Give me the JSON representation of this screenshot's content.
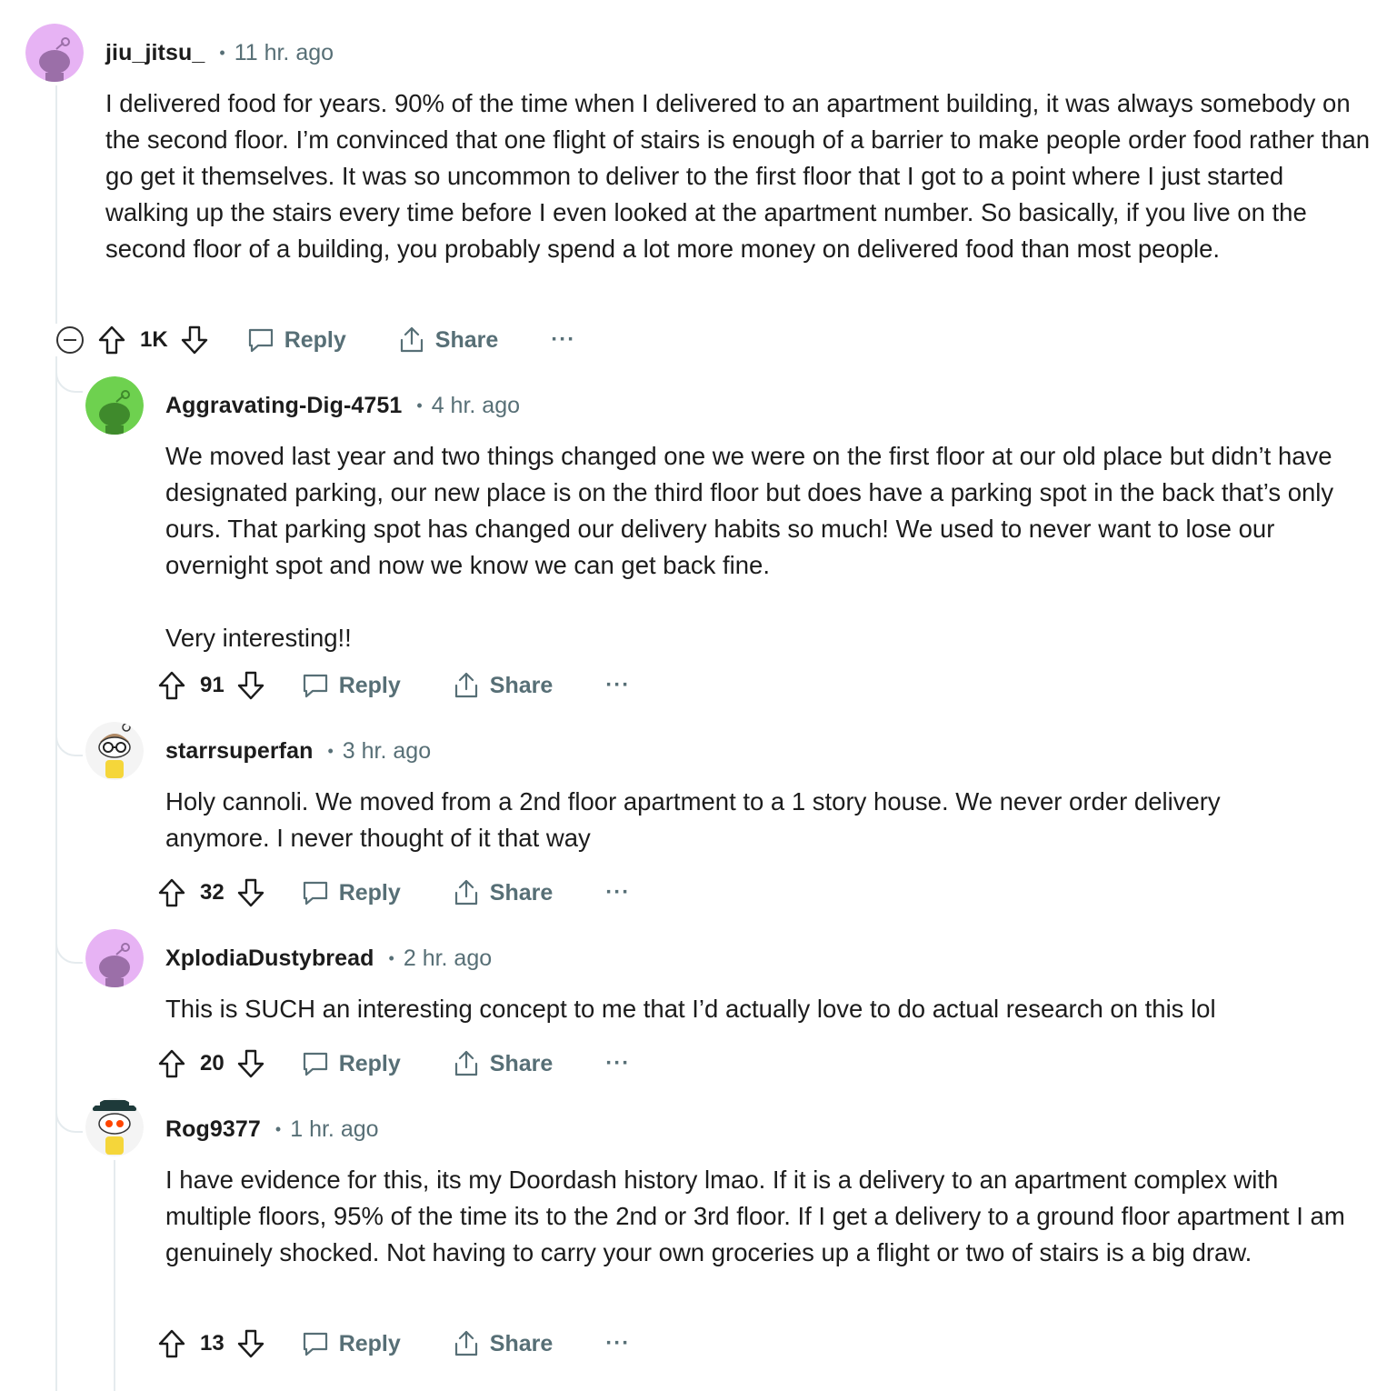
{
  "colors": {
    "meta_text": "#576f76",
    "thread_line": "#e5ebee",
    "text": "#1c1c1c"
  },
  "comments": [
    {
      "author": "jiu_jitsu_",
      "separator": "•",
      "time": "11 hr. ago",
      "body": "I delivered food for years. 90% of the time when I delivered to an apartment building, it was always somebody on the second floor. I’m convinced that one flight of stairs is enough of a barrier to make people order food rather than go get it themselves. It was so uncommon to deliver to the first floor that I got to a point where I just started walking up the stairs every time before I even looked at the apartment number. So basically, if you live on the second floor of a building, you probably spend a lot more money on delivered food than most people.",
      "score": "1K",
      "reply_label": "Reply",
      "share_label": "Share",
      "more_label": "···",
      "avatar": "snoo-purple"
    },
    {
      "author": "Aggravating-Dig-4751",
      "separator": "•",
      "time": "4 hr. ago",
      "body": "We moved last year and two things changed one we were on the first floor at our old place but didn’t have designated parking, our new place is on the third floor but does have a parking spot in the back that’s only ours. That parking spot has changed our delivery habits so much! We used to never want to lose our overnight spot and now we know we can get back fine.\n\nVery interesting!!",
      "score": "91",
      "reply_label": "Reply",
      "share_label": "Share",
      "more_label": "···",
      "avatar": "snoo-green"
    },
    {
      "author": "starrsuperfan",
      "separator": "•",
      "time": "3 hr. ago",
      "body": "Holy cannoli. We moved from a 2nd floor apartment to a 1 story house. We never order delivery anymore. I never thought of it that way",
      "score": "32",
      "reply_label": "Reply",
      "share_label": "Share",
      "more_label": "···",
      "avatar": "snoo-glasses"
    },
    {
      "author": "XplodiaDustybread",
      "separator": "•",
      "time": "2 hr. ago",
      "body": "This is SUCH an interesting concept to me that I’d actually love to do actual research on this lol",
      "score": "20",
      "reply_label": "Reply",
      "share_label": "Share",
      "more_label": "···",
      "avatar": "snoo-purple"
    },
    {
      "author": "Rog9377",
      "separator": "•",
      "time": "1 hr. ago",
      "body": "I have evidence for this, its my Doordash history lmao. If it is a delivery to an apartment complex with multiple floors, 95% of the time its to the 2nd or 3rd floor. If I get a delivery to a ground floor apartment I am genuinely shocked. Not having to carry your own groceries up a flight or two of stairs is a big draw.",
      "score": "13",
      "reply_label": "Reply",
      "share_label": "Share",
      "more_label": "···",
      "avatar": "snoo-hat"
    }
  ]
}
